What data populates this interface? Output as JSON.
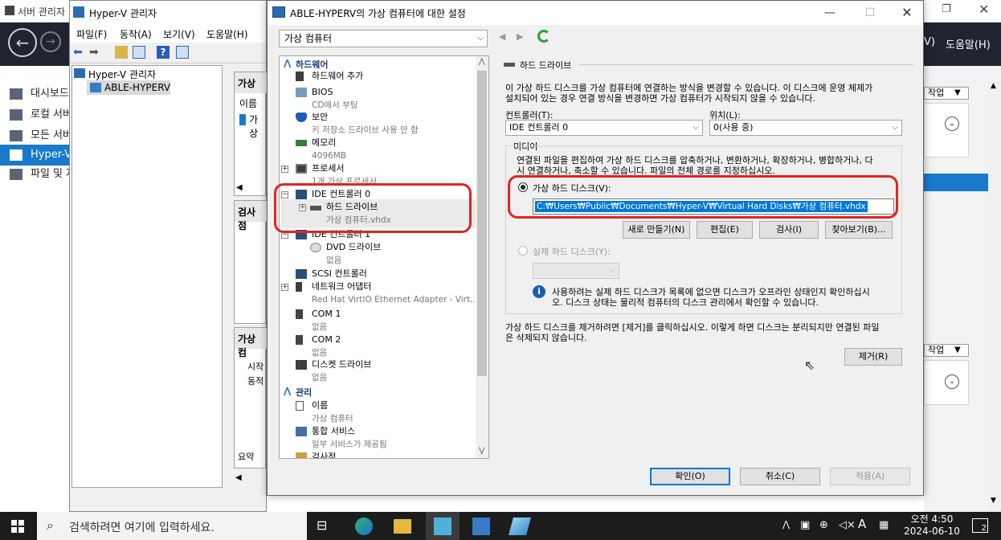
{
  "server_manager": {
    "title": "서버 관리자",
    "right_menu": [
      "V)",
      "도움말(H)"
    ],
    "sidebar": [
      {
        "label": "대시보드"
      },
      {
        "label": "로컬 서버"
      },
      {
        "label": "모든 서버"
      },
      {
        "label": "Hyper-V"
      },
      {
        "label": "파일 및 저장소"
      }
    ],
    "task_label": "작업"
  },
  "hyperv_manager": {
    "title": "Hyper-V 관리자",
    "menu": [
      "파일(F)",
      "동작(A)",
      "보기(V)",
      "도움말(H)"
    ],
    "tree_root": "Hyper-V 관리자",
    "tree_child": "ABLE-HYPERV",
    "mid_header1": "가상",
    "mid_col": "이름",
    "mid_row": "가상",
    "mid_header2": "검사점",
    "mid_header3": "가상 컴",
    "mid_line1": "시작",
    "mid_line2": "동적",
    "mid_tab": "요약"
  },
  "dialog": {
    "title": "ABLE-HYPERV의 가상 컴퓨터에 대한 설정",
    "vm_select": "가상 컴퓨터",
    "hardware_section": "하드웨어",
    "management_section": "관리",
    "hardware_items": [
      {
        "name": "하드웨어 추가",
        "sub": ""
      },
      {
        "name": "BIOS",
        "sub": "CD에서 부팅"
      },
      {
        "name": "보안",
        "sub": "키 저장소 드라이브 사용 안 함"
      },
      {
        "name": "메모리",
        "sub": "4096MB"
      },
      {
        "name": "프로세서",
        "sub": "1개 가상 프로세서"
      },
      {
        "name": "IDE 컨트롤러 0",
        "sub": ""
      },
      {
        "name": "하드 드라이브",
        "sub": "가상 컴퓨터.vhdx"
      },
      {
        "name": "IDE 컨트롤러 1",
        "sub": ""
      },
      {
        "name": "DVD 드라이브",
        "sub": "없음"
      },
      {
        "name": "SCSI 컨트롤러",
        "sub": ""
      },
      {
        "name": "네트워크 어댑터",
        "sub": "Red Hat VirtIO Ethernet Adapter - Virt..."
      },
      {
        "name": "COM 1",
        "sub": "없음"
      },
      {
        "name": "COM 2",
        "sub": "없음"
      },
      {
        "name": "디스켓 드라이브",
        "sub": "없음"
      }
    ],
    "management_items": [
      {
        "name": "이름",
        "sub": "가상 컴퓨터"
      },
      {
        "name": "통합 서비스",
        "sub": "일부 서비스가 제공됨"
      },
      {
        "name": "검사점",
        "sub": ""
      }
    ],
    "panel": {
      "heading": "하드 드라이브",
      "desc_line1": "이 가상 하드 디스크를 가상 컴퓨터에 연결하는 방식을 변경할 수 있습니다. 이 디스크에 운영 체제가",
      "desc_line2": "설치되어 있는 경우 연결 방식을 변경하면 가상 컴퓨터가 시작되지 않을 수 있습니다.",
      "controller_label": "컨트롤러(T):",
      "controller_value": "IDE 컨트롤러 0",
      "location_label": "위치(L):",
      "location_value": "0(사용 중)",
      "media_label": "미디어",
      "media_desc_line1": "연결된 파일을 편집하여 가상 하드 디스크를 압축하거나, 변환하거나, 확장하거나, 병합하거나, 다",
      "media_desc_line2": "시 연결하거나, 축소할 수 있습니다. 파일의 전체 경로를 지정하십시오.",
      "vhd_radio": "가상 하드 디스크(V):",
      "vhd_path": "C:₩Users₩Public₩Documents₩Hyper-V₩Virtual Hard Disks₩가상 컴퓨터.vhdx",
      "btn_new": "새로 만들기(N)",
      "btn_edit": "편집(E)",
      "btn_inspect": "검사(I)",
      "btn_browse": "찾아보기(B)...",
      "physical_radio": "실제 하드 디스크(Y):",
      "info_line1": "사용하려는 실제 하드 디스크가 목록에 없으면 디스크가 오프라인 상태인지 확인하십시",
      "info_line2": "오. 디스크 상태는 물리적 컴퓨터의 디스크 관리에서 확인할 수 있습니다.",
      "remove_line1": "가상 하드 디스크를 제거하려면 [제거]를 클릭하십시오. 이렇게 하면 디스크는 분리되지만 연결된 파일",
      "remove_line2": "은 삭제되지 않습니다.",
      "btn_remove": "제거(R)"
    },
    "btn_ok": "확인(O)",
    "btn_cancel": "취소(C)",
    "btn_apply": "적용(A)"
  },
  "taskbar": {
    "search_placeholder": "검색하려면 여기에 입력하세요.",
    "time": "오전 4:50",
    "date": "2024-06-10",
    "ime": "A",
    "notif_count": "2"
  }
}
